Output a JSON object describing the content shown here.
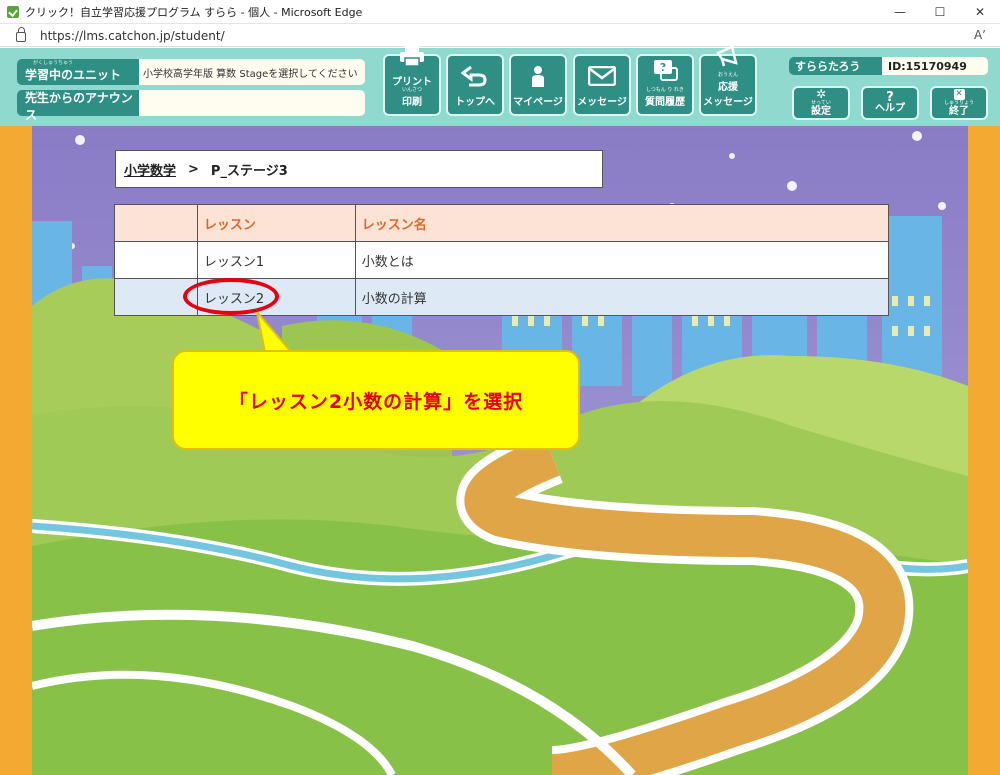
{
  "window": {
    "title": "クリック！自立学習応援プログラム すらら - 個人 - Microsoft Edge",
    "controls": [
      "—",
      "☐",
      "✕"
    ]
  },
  "address": {
    "url": "https://lms.catchon.jp/student/",
    "read_aloud": "Aʼ"
  },
  "header": {
    "unit_label": "学習中のユニット",
    "unit_ruby": "がくしゅうちゅう",
    "unit_value": "小学校高学年版 算数 Stageを選択してください",
    "announce_label": "先生からのアナウンス",
    "announce_ruby": "せんせい",
    "announce_value": "",
    "nav": [
      {
        "label": "プリント",
        "label2": "印刷",
        "ruby": "いんさつ",
        "icon": "printer-icon"
      },
      {
        "label": "トップへ",
        "label2": "",
        "ruby": "",
        "icon": "return-arrow-icon"
      },
      {
        "label": "マイページ",
        "label2": "",
        "ruby": "",
        "icon": "person-icon"
      },
      {
        "label": "メッセージ",
        "label2": "",
        "ruby": "",
        "icon": "envelope-icon"
      },
      {
        "label": "質問履歴",
        "label2": "",
        "ruby": "しつもん り れき",
        "icon": "question-bubble-icon"
      },
      {
        "label": "応援",
        "label2": "メッセージ",
        "ruby": "おうえん",
        "icon": "megaphone-icon"
      }
    ],
    "user_name": "すららたろう",
    "user_id": "ID:15170949",
    "settings": {
      "label": "設定",
      "ruby": "せってい",
      "icon": "gear-icon"
    },
    "help": {
      "label": "ヘルプ",
      "icon": "question-icon"
    },
    "exit": {
      "label": "終了",
      "ruby": "しゅうりょう",
      "icon": "close-box-icon"
    }
  },
  "breadcrumb": {
    "subject": "小学数学",
    "separator": ">",
    "stage": "P_ステージ3"
  },
  "lessons": {
    "headers": [
      "",
      "レッスン",
      "レッスン名"
    ],
    "rows": [
      {
        "num": "レッスン1",
        "name": "小数とは"
      },
      {
        "num": "レッスン2",
        "name": "小数の計算"
      }
    ]
  },
  "callout": {
    "text": "「レッスン2小数の計算」を選択"
  },
  "colors": {
    "header_bg": "#8fd9cf",
    "button_bg": "#2f8f84",
    "side_orange": "#f4a933",
    "callout_yellow": "#ffff00",
    "callout_red": "#e60012"
  }
}
